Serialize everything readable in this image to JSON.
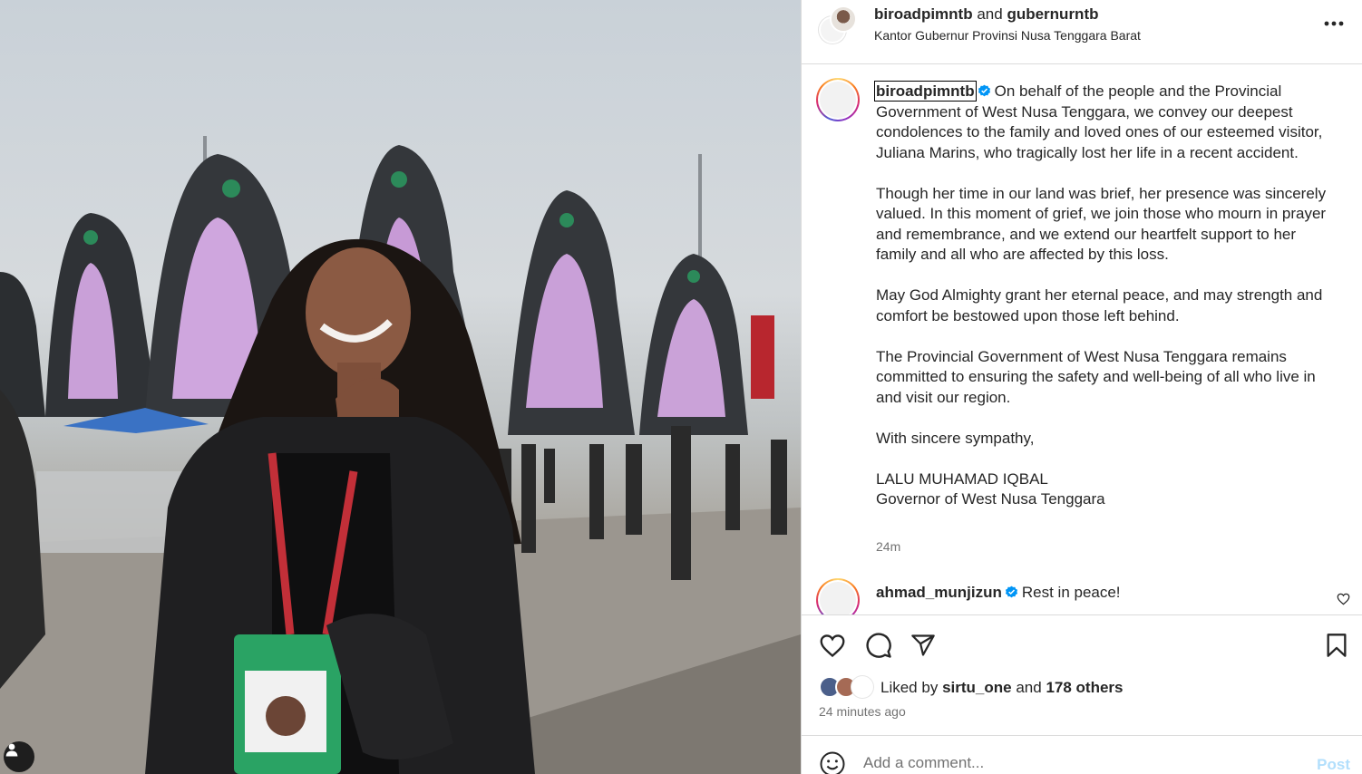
{
  "colors": {
    "accent_blue": "#0095f6",
    "verified_blue": "#0095f6",
    "post_disabled": "#b2dffc",
    "muted_text": "#737373",
    "border": "#dbdbdb"
  },
  "icons": {
    "more": "more-horizontal-icon",
    "verified": "verified-badge-icon",
    "like": "heart-icon",
    "comment": "comment-bubble-icon",
    "share": "send-paper-plane-icon",
    "save": "bookmark-icon",
    "emoji": "emoji-smile-icon",
    "media_user": "user-tag-icon"
  },
  "header": {
    "user1": "biroadpimntb",
    "joiner": "and",
    "user2": "gubernurntb",
    "location": "Kantor Gubernur Provinsi Nusa Tenggara Barat"
  },
  "caption": {
    "username": "biroadpimntb",
    "paragraphs": [
      "On behalf of the people and the Provincial Government of West Nusa Tenggara, we convey our deepest condolences to the family and loved ones of our esteemed visitor, Juliana Marins, who tragically lost her life in a recent accident.",
      "Though her time in our land was brief, her presence was sincerely valued. In this moment of grief, we join those who mourn in prayer and remembrance, and we extend our heartfelt support to her family and all who are affected by this loss.",
      "May God Almighty grant her eternal peace, and may strength and comfort be bestowed upon those left behind.",
      "The Provincial Government of West Nusa Tenggara remains committed to ensuring the safety and well-being of all who live in and visit our region.",
      "With sincere sympathy,",
      "LALU MUHAMAD IQBAL\nGovernor of West Nusa Tenggara"
    ],
    "time": "24m"
  },
  "reply": {
    "username": "ahmad_munjizun",
    "text": "Rest in peace!"
  },
  "likes": {
    "prefix": "Liked by",
    "user": "sirtu_one",
    "joiner": "and",
    "others": "178 others"
  },
  "post_time": "24 minutes ago",
  "comment_box": {
    "placeholder": "Add a comment...",
    "post_label": "Post"
  }
}
